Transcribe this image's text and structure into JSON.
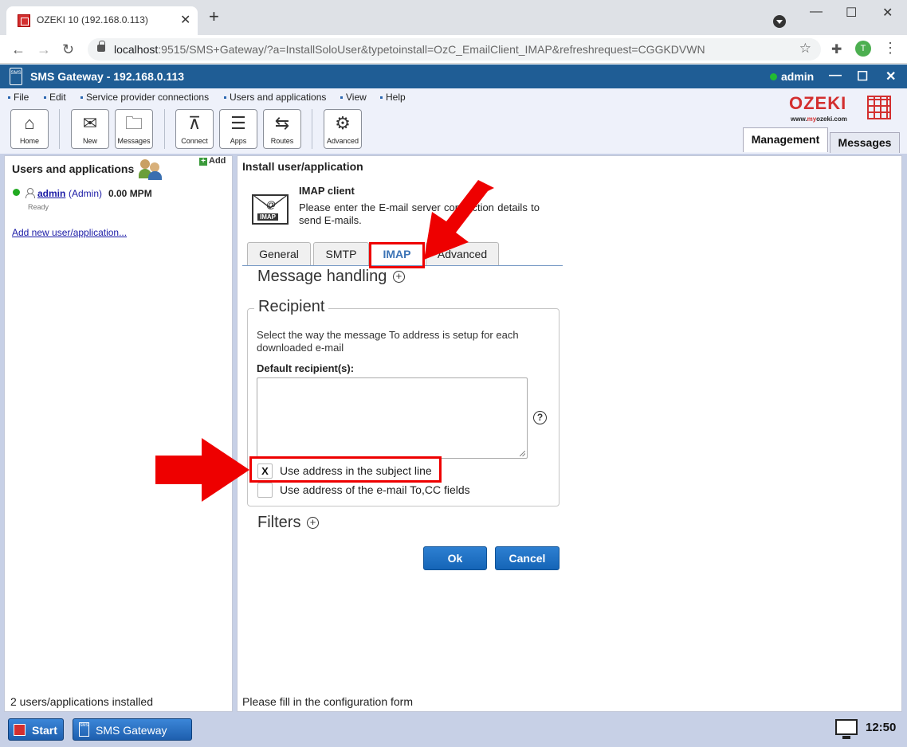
{
  "browser": {
    "tab_title": "OZEKI 10 (192.168.0.113)",
    "url_host": "localhost",
    "url_rest": ":9515/SMS+Gateway/?a=InstallSoloUser&typetoinstall=OzC_EmailClient_IMAP&refreshrequest=CGGKDVWN",
    "profile_initial": "T"
  },
  "app": {
    "title": "SMS Gateway - 192.168.0.113",
    "user": "admin",
    "sms_glyph": "SMS"
  },
  "menu": [
    "File",
    "Edit",
    "Service provider connections",
    "Users and applications",
    "View",
    "Help"
  ],
  "toolbar": {
    "home": "Home",
    "new": "New",
    "messages": "Messages",
    "connect": "Connect",
    "apps": "Apps",
    "routes": "Routes",
    "advanced": "Advanced"
  },
  "logo": {
    "word": "OZEKI",
    "sub_pre": "www.",
    "sub_red": "my",
    "sub_post": "ozeki.com"
  },
  "main_tabs": {
    "management": "Management",
    "messages": "Messages"
  },
  "left_panel": {
    "title": "Users and applications",
    "add_label": "Add",
    "user": {
      "name": "admin",
      "role": "(Admin)",
      "rate": "0.00 MPM",
      "state": "Ready"
    },
    "new_link": "Add new user/application...",
    "status": "2 users/applications installed"
  },
  "right_panel": {
    "title": "Install user/application",
    "app_name": "IMAP client",
    "app_desc": "Please enter the E-mail server connection details to send E-mails.",
    "envelope_label": "IMAP",
    "tabs": [
      "General",
      "SMTP",
      "IMAP",
      "Advanced"
    ],
    "message_handling": "Message handling",
    "recipient_legend": "Recipient",
    "recipient_help": "Select the way the message To address is setup for each downloaded e-mail",
    "default_recipients_label": "Default recipient(s):",
    "default_recipients_value": "",
    "cb_subject": {
      "label": "Use address in the subject line",
      "mark": "X"
    },
    "cb_tocc": {
      "label": "Use address of the e-mail To,CC fields",
      "mark": ""
    },
    "filters": "Filters",
    "ok": "Ok",
    "cancel": "Cancel",
    "status": "Please fill in the configuration form"
  },
  "taskbar": {
    "start": "Start",
    "app": "SMS Gateway",
    "clock": "12:50"
  },
  "colors": {
    "brand_blue": "#1f5d95",
    "ozeki_red": "#d32f2f",
    "highlight_red": "#ee0000",
    "active_tab_text": "#3b73b5"
  }
}
